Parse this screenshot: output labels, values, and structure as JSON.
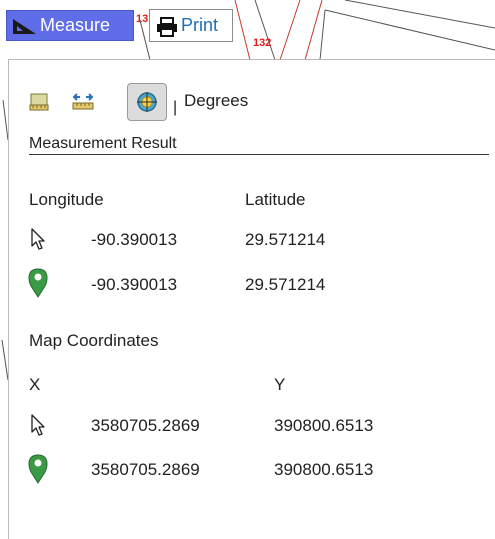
{
  "toolbar": {
    "measure_label": "Measure",
    "print_label": "Print"
  },
  "map_labels": [
    "13",
    "132"
  ],
  "panel": {
    "unit_separator": "|",
    "unit_label": "Degrees",
    "section_title": "Measurement Result",
    "geo": {
      "headers": [
        "Longitude",
        "Latitude"
      ],
      "rows": [
        {
          "icon": "cursor-arrow-icon",
          "x": "-90.390013",
          "y": "29.571214"
        },
        {
          "icon": "map-pin-icon",
          "x": "-90.390013",
          "y": "29.571214"
        }
      ]
    },
    "map_coords": {
      "title": "Map Coordinates",
      "headers": [
        "X",
        "Y"
      ],
      "rows": [
        {
          "icon": "cursor-arrow-icon",
          "x": "3580705.2869",
          "y": "390800.6513"
        },
        {
          "icon": "map-pin-icon",
          "x": "3580705.2869",
          "y": "390800.6513"
        }
      ]
    }
  },
  "colors": {
    "measure_button": "#5f6ee8",
    "print_text": "#1f6fb5",
    "pin": "#3a9a45",
    "map_line": "#c0392b"
  }
}
